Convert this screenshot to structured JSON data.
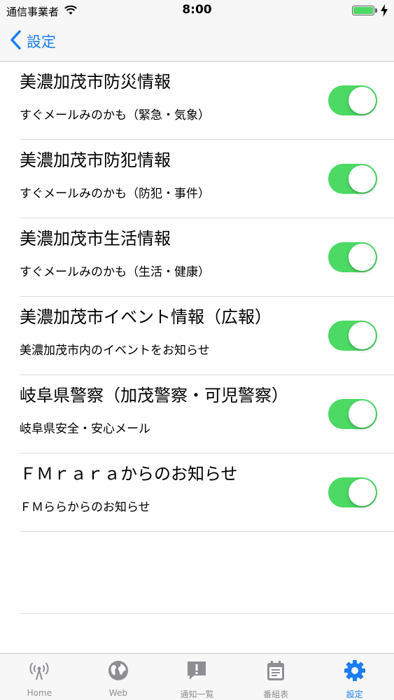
{
  "status": {
    "carrier": "通信事業者",
    "time": "8:00"
  },
  "nav": {
    "back_label": "設定"
  },
  "items": [
    {
      "title": "美濃加茂市防災情報",
      "subtitle": "すぐメールみのかも（緊急・気象）",
      "enabled": true
    },
    {
      "title": "美濃加茂市防犯情報",
      "subtitle": "すぐメールみのかも（防犯・事件）",
      "enabled": true
    },
    {
      "title": "美濃加茂市生活情報",
      "subtitle": "すぐメールみのかも（生活・健康）",
      "enabled": true
    },
    {
      "title": "美濃加茂市イベント情報（広報）",
      "subtitle": "美濃加茂市内のイベントをお知らせ",
      "enabled": true
    },
    {
      "title": "岐阜県警察（加茂警察・可児警察）",
      "subtitle": "岐阜県安全・安心メール",
      "enabled": true
    },
    {
      "title": "ＦＭｒａｒａからのお知らせ",
      "subtitle": "ＦＭららからのお知らせ",
      "enabled": true
    }
  ],
  "tabs": [
    {
      "label": "Home",
      "icon": "broadcast-icon",
      "active": false
    },
    {
      "label": "Web",
      "icon": "globe-icon",
      "active": false
    },
    {
      "label": "通知一覧",
      "icon": "notification-list-icon",
      "active": false
    },
    {
      "label": "番組表",
      "icon": "calendar-icon",
      "active": false
    },
    {
      "label": "設定",
      "icon": "gear-icon",
      "active": true
    }
  ],
  "colors": {
    "accent": "#1a7cf2",
    "toggle_on": "#4cd964",
    "tab_inactive": "#8e8e93"
  }
}
